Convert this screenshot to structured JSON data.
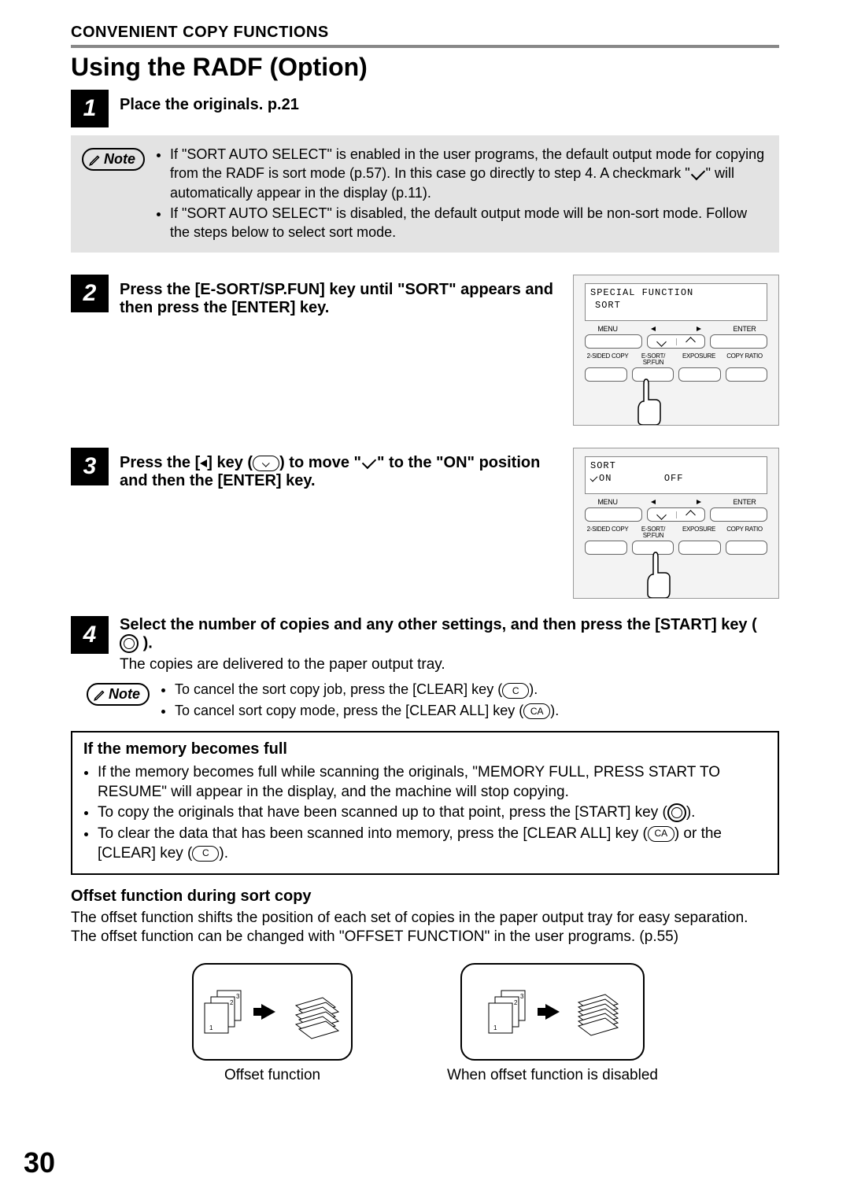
{
  "header": "CONVENIENT COPY FUNCTIONS",
  "title": "Using the RADF (Option)",
  "page_number": "30",
  "steps": {
    "s1": {
      "num": "1",
      "text": "Place the originals. p.21"
    },
    "s2": {
      "num": "2",
      "text": "Press the [E-SORT/SP.FUN] key until \"SORT\" appears and then press the [ENTER] key."
    },
    "s3": {
      "num": "3",
      "text_pre": "Press the [",
      "text_mid1": "] key (",
      "text_mid2": ") to move \"",
      "text_post": "\" to the \"ON\" position and then the [ENTER] key."
    },
    "s4": {
      "num": "4",
      "text_pre": "Select the number of copies and any other settings, and then press the [START] key (",
      "text_post": ").",
      "sub": "The copies are delivered to the paper output tray."
    }
  },
  "note1": {
    "label": "Note",
    "b1_pre": "If \"SORT AUTO SELECT\" is enabled in the user programs, the default output mode for copying from the RADF is sort mode (p.57). In this case go directly to step 4. A checkmark \"",
    "b1_post": "\" will automatically appear in the display (p.11).",
    "b2": "If \"SORT AUTO SELECT\" is disabled, the default output mode will be non-sort mode. Follow the steps below to select sort mode."
  },
  "note2": {
    "label": "Note",
    "b1_pre": "To cancel the sort copy job, press the [CLEAR] key (",
    "b1_post": ").",
    "b2_pre": "To cancel sort copy mode, press the [CLEAR ALL] key (",
    "b2_post": ")."
  },
  "panel": {
    "lcd1_line1": "SPECIAL FUNCTION",
    "lcd1_line2": "SORT",
    "lcd2_line1": "SORT",
    "lcd2_on": "ON",
    "lcd2_off": "OFF",
    "lbl_menu": "MENU",
    "lbl_enter": "ENTER",
    "lbl_2sided": "2-SIDED COPY",
    "lbl_esort": "E-SORT/ SP.FUN",
    "lbl_exposure": "EXPOSURE",
    "lbl_ratio": "COPY RATIO"
  },
  "memory": {
    "title": "If the memory becomes full",
    "b1": "If the memory becomes full while scanning the originals, \"MEMORY FULL, PRESS START TO RESUME\" will appear in the display, and the machine will stop copying.",
    "b2_pre": "To copy the originals that have been scanned up to that point, press the [START] key (",
    "b2_post": ").",
    "b3_pre": "To clear the data that has been scanned into memory, press the [CLEAR ALL] key (",
    "b3_mid": ") or the [CLEAR] key (",
    "b3_post": ")."
  },
  "offset": {
    "title": "Offset function during sort copy",
    "p1": "The offset function shifts the position of each set of copies in the paper output tray for easy separation.",
    "p2": "The offset function can be changed with \"OFFSET FUNCTION\" in the user programs. (p.55)",
    "cap1": "Offset function",
    "cap2": "When offset function is disabled"
  },
  "keys": {
    "c": "C",
    "ca": "CA"
  }
}
